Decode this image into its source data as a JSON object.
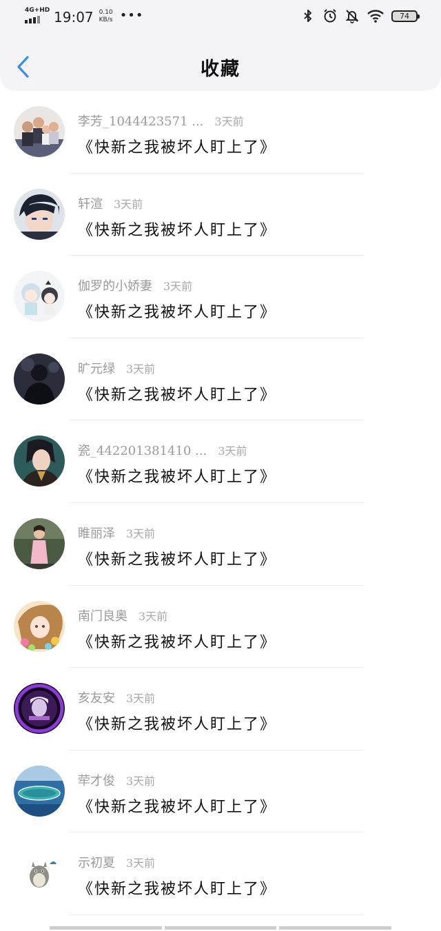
{
  "status_bar": {
    "network": "4G+HD",
    "time": "19:07",
    "speed_value": "0.10",
    "speed_unit": "KB/s",
    "more": "•••",
    "battery": "74"
  },
  "nav": {
    "title": "收藏"
  },
  "items": [
    {
      "user": "李芳_1044423571 ...",
      "ago": "3天前",
      "content": "《快新之我被坏人盯上了》",
      "avatar": "family-photo"
    },
    {
      "user": "轩渲",
      "ago": "3天前",
      "content": "《快新之我被坏人盯上了》",
      "avatar": "anime-detective"
    },
    {
      "user": "伽罗的小娇妻",
      "ago": "3天前",
      "content": "《快新之我被坏人盯上了》",
      "avatar": "chibi-pair"
    },
    {
      "user": "旷元绿",
      "ago": "3天前",
      "content": "《快新之我被坏人盯上了》",
      "avatar": "dark-figure"
    },
    {
      "user": "瓷_442201381410 ...",
      "ago": "3天前",
      "content": "《快新之我被坏人盯上了》",
      "avatar": "anime-man"
    },
    {
      "user": "睢丽泽",
      "ago": "3天前",
      "content": "《快新之我被坏人盯上了》",
      "avatar": "child-pink"
    },
    {
      "user": "南门良奥",
      "ago": "3天前",
      "content": "《快新之我被坏人盯上了》",
      "avatar": "anime-girl"
    },
    {
      "user": "亥友安",
      "ago": "3天前",
      "content": "《快新之我被坏人盯上了》",
      "avatar": "purple-ring"
    },
    {
      "user": "荦才俊",
      "ago": "3天前",
      "content": "《快新之我被坏人盯上了》",
      "avatar": "island"
    },
    {
      "user": "示初夏",
      "ago": "3天前",
      "content": "《快新之我被坏人盯上了》",
      "avatar": "totoro"
    }
  ]
}
